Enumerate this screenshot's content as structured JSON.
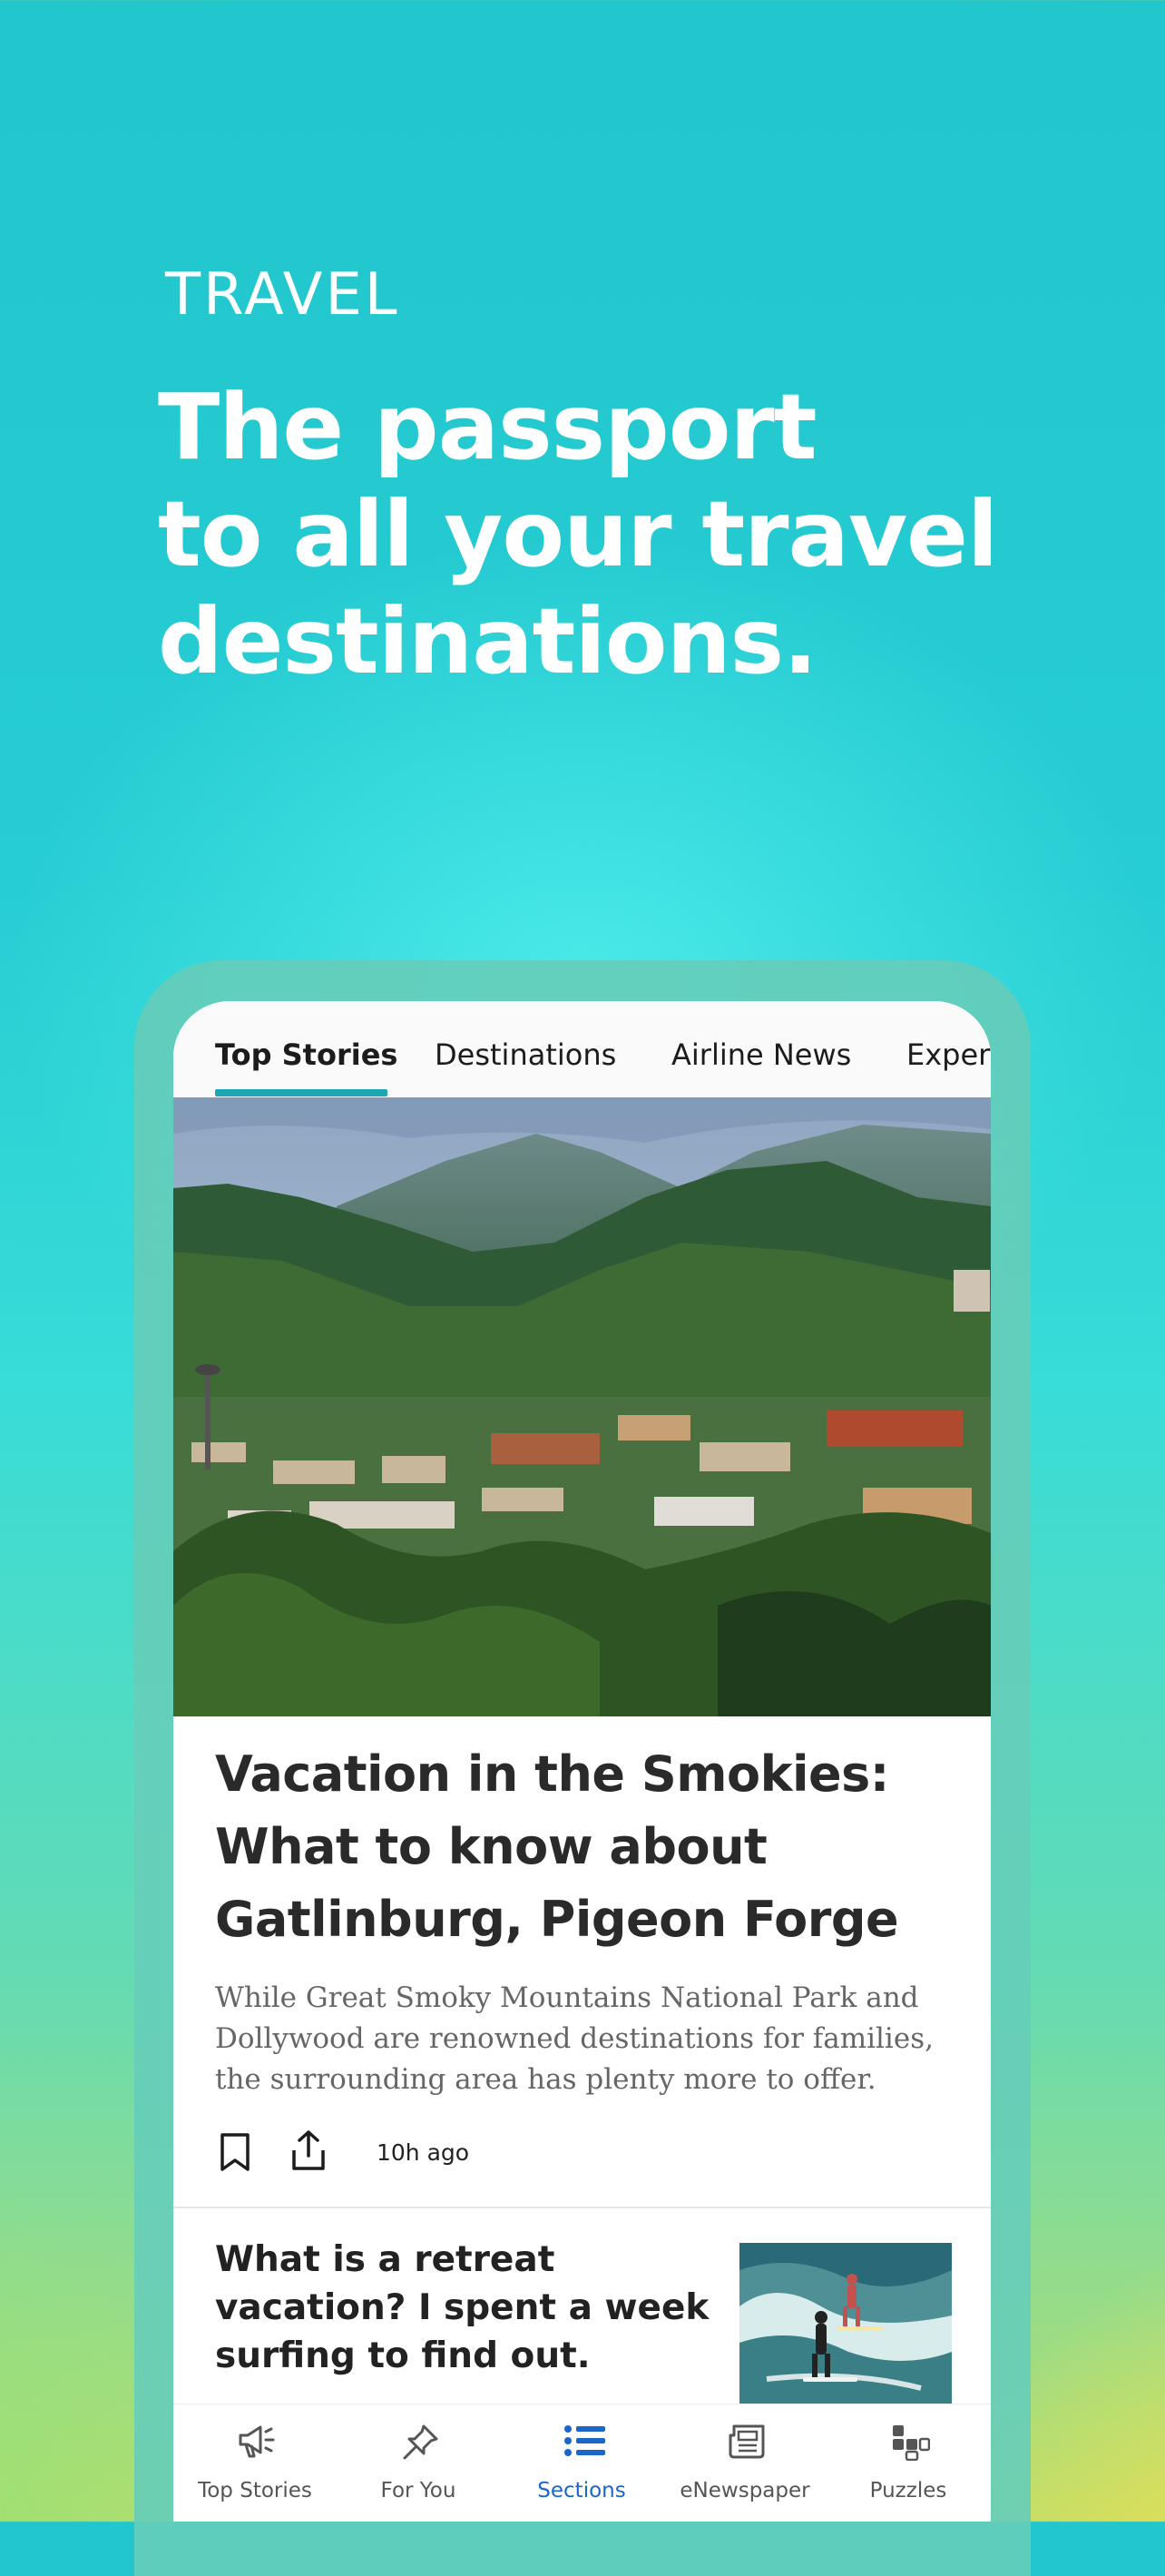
{
  "promo": {
    "eyebrow": "TRAVEL",
    "headline_lines": [
      "The passport",
      "to all your travel",
      "destinations."
    ]
  },
  "tabs": [
    {
      "label": "Top Stories",
      "active": true
    },
    {
      "label": "Destinations"
    },
    {
      "label": "Airline News"
    },
    {
      "label": "Exper"
    }
  ],
  "lead_story": {
    "title_lines": [
      "Vacation in the Smokies:",
      "What to know about",
      "Gatlinburg, Pigeon Forge"
    ],
    "summary_lines": [
      "While Great Smoky Mountains National Park and",
      "Dollywood are renowned destinations for families,",
      "the surrounding area has plenty more to offer."
    ],
    "timestamp": "10h ago",
    "actions": {
      "bookmark_icon": "bookmark-icon",
      "share_icon": "share-icon"
    }
  },
  "second_story": {
    "title_lines": [
      "What is a retreat",
      "vacation? I spent a week",
      "surfing to find out."
    ]
  },
  "bottom_nav": [
    {
      "label": "Top Stories",
      "icon": "megaphone-icon"
    },
    {
      "label": "For You",
      "icon": "pin-icon"
    },
    {
      "label": "Sections",
      "icon": "list-icon",
      "active": true
    },
    {
      "label": "eNewspaper",
      "icon": "newspaper-icon"
    },
    {
      "label": "Puzzles",
      "icon": "puzzle-icon"
    }
  ],
  "colors": {
    "accent": "#1ba8b4",
    "nav_active": "#1a67c8",
    "background_top": "#22c6cd",
    "background_bottom_right": "#fbe04a"
  }
}
